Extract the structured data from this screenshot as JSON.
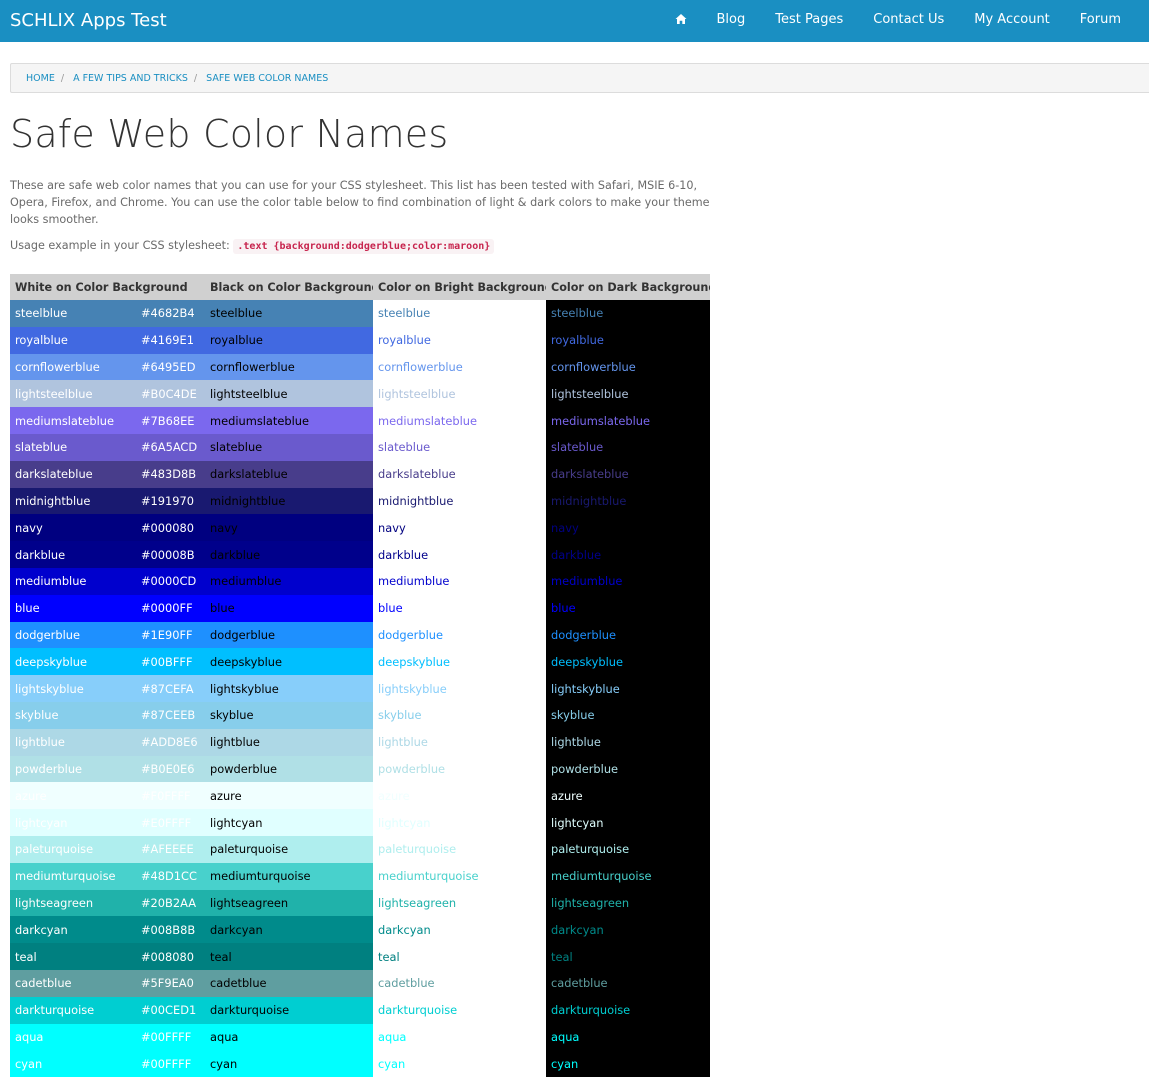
{
  "navbar": {
    "brand": "SCHLIX Apps Test",
    "home_icon": "home-icon",
    "items": [
      "Blog",
      "Test Pages",
      "Contact Us",
      "My Account",
      "Forum"
    ],
    "color": "#1a8fc2"
  },
  "breadcrumb": [
    "HOME",
    "A FEW TIPS AND TRICKS",
    "SAFE WEB COLOR NAMES"
  ],
  "page": {
    "title": "Safe Web Color Names",
    "intro": "These are safe web color names that you can use for your CSS stylesheet. This list has been tested with Safari, MSIE 6-10, Opera, Firefox, and Chrome. You can use the color table below to find combination of light & dark colors to make your theme looks smoother.",
    "usage_label": "Usage example in your CSS stylesheet:",
    "usage_code": ".text {background:dodgerblue;color:maroon}"
  },
  "table": {
    "headers": [
      "White on Color Background",
      "Black on Color Background",
      "Color on Bright Background",
      "Color on Dark Background"
    ],
    "rows": [
      {
        "name": "steelblue",
        "hex": "#4682B4"
      },
      {
        "name": "royalblue",
        "hex": "#4169E1"
      },
      {
        "name": "cornflowerblue",
        "hex": "#6495ED"
      },
      {
        "name": "lightsteelblue",
        "hex": "#B0C4DE"
      },
      {
        "name": "mediumslateblue",
        "hex": "#7B68EE"
      },
      {
        "name": "slateblue",
        "hex": "#6A5ACD"
      },
      {
        "name": "darkslateblue",
        "hex": "#483D8B"
      },
      {
        "name": "midnightblue",
        "hex": "#191970"
      },
      {
        "name": "navy",
        "hex": "#000080"
      },
      {
        "name": "darkblue",
        "hex": "#00008B"
      },
      {
        "name": "mediumblue",
        "hex": "#0000CD"
      },
      {
        "name": "blue",
        "hex": "#0000FF"
      },
      {
        "name": "dodgerblue",
        "hex": "#1E90FF"
      },
      {
        "name": "deepskyblue",
        "hex": "#00BFFF"
      },
      {
        "name": "lightskyblue",
        "hex": "#87CEFA"
      },
      {
        "name": "skyblue",
        "hex": "#87CEEB"
      },
      {
        "name": "lightblue",
        "hex": "#ADD8E6"
      },
      {
        "name": "powderblue",
        "hex": "#B0E0E6"
      },
      {
        "name": "azure",
        "hex": "#F0FFFF"
      },
      {
        "name": "lightcyan",
        "hex": "#E0FFFF"
      },
      {
        "name": "paleturquoise",
        "hex": "#AFEEEE"
      },
      {
        "name": "mediumturquoise",
        "hex": "#48D1CC"
      },
      {
        "name": "lightseagreen",
        "hex": "#20B2AA"
      },
      {
        "name": "darkcyan",
        "hex": "#008B8B"
      },
      {
        "name": "teal",
        "hex": "#008080"
      },
      {
        "name": "cadetblue",
        "hex": "#5F9EA0"
      },
      {
        "name": "darkturquoise",
        "hex": "#00CED1"
      },
      {
        "name": "aqua",
        "hex": "#00FFFF"
      },
      {
        "name": "cyan",
        "hex": "#00FFFF"
      }
    ]
  }
}
